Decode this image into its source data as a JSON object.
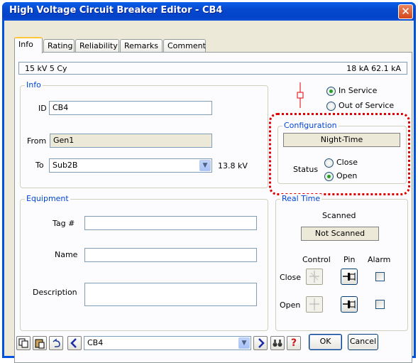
{
  "window": {
    "title": "High Voltage Circuit Breaker Editor - CB4",
    "close_glyph": "✕"
  },
  "tabs": [
    "Info",
    "Rating",
    "Reliability",
    "Remarks",
    "Comment"
  ],
  "summary": {
    "left": "15 kV  5 Cy",
    "right": "18 kA  62.1 kA"
  },
  "info": {
    "legend": "Info",
    "id_label": "ID",
    "id_value": "CB4",
    "from_label": "From",
    "from_value": "Gen1",
    "to_label": "To",
    "to_value": "Sub2B",
    "to_kv": "13.8 kV"
  },
  "service": {
    "in_label": "In Service",
    "out_label": "Out of Service",
    "selected": "in"
  },
  "configuration": {
    "legend": "Configuration",
    "value": "Night-Time",
    "status_label": "Status",
    "close_label": "Close",
    "open_label": "Open",
    "selected": "open"
  },
  "equipment": {
    "legend": "Equipment",
    "tag_label": "Tag #",
    "tag_value": "",
    "name_label": "Name",
    "name_value": "",
    "desc_label": "Description",
    "desc_value": ""
  },
  "realtime": {
    "legend": "Real Time",
    "scanned_label": "Scanned",
    "scanned_value": "Not Scanned",
    "col_control": "Control",
    "col_pin": "Pin",
    "col_alarm": "Alarm",
    "row_close": "Close",
    "row_open": "Open"
  },
  "footer": {
    "nav_value": "CB4",
    "ok_label": "OK",
    "cancel_label": "Cancel",
    "help_glyph": "?"
  },
  "colors": {
    "accent": "#0046d5",
    "highlight": "#e00000",
    "help": "#d01818"
  }
}
